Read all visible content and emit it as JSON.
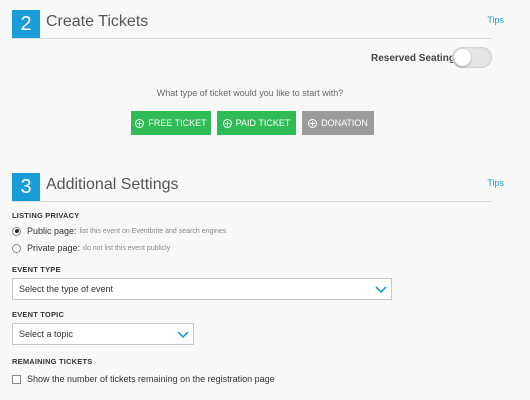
{
  "section1": {
    "number": "2",
    "title": "Create Tickets",
    "tips": "Tips"
  },
  "reserved_seating": {
    "label": "Reserved Seating:",
    "enabled": false
  },
  "ticket_prompt": "What type of ticket would you like to start with?",
  "ticket_buttons": {
    "free": "FREE TICKET",
    "paid": "PAID TICKET",
    "donation": "DONATION"
  },
  "section2": {
    "number": "3",
    "title": "Additional Settings",
    "tips": "Tips"
  },
  "listing_privacy": {
    "label": "LISTING PRIVACY",
    "options": [
      {
        "label": "Public page:",
        "note": "list this event on Eventbrite and search engines",
        "selected": true
      },
      {
        "label": "Private page:",
        "note": "do not list this event publicly",
        "selected": false
      }
    ]
  },
  "event_type": {
    "label": "EVENT TYPE",
    "value": "Select the type of event"
  },
  "event_topic": {
    "label": "EVENT TOPIC",
    "value": "Select a topic"
  },
  "remaining_tickets": {
    "label": "REMAINING TICKETS",
    "checkbox_label": "Show the number of tickets remaining on the registration page",
    "checked": false
  },
  "colors": {
    "accent_blue": "#1a9cd8",
    "button_green": "#2fbb55",
    "button_gray": "#9b9b9b"
  }
}
